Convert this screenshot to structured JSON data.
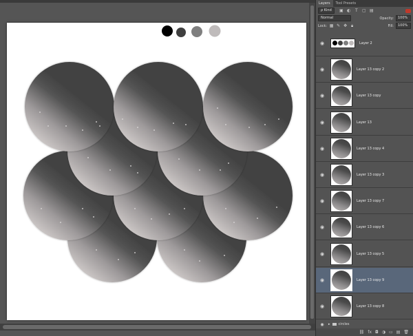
{
  "panel": {
    "tabs": [
      "Layers",
      "Tool Presets"
    ],
    "kind_label": "ρ Kind",
    "blend_mode": "Normal",
    "opacity_label": "Opacity:",
    "opacity_value": "100%",
    "lock_label": "Lock:",
    "fill_label": "Fill:",
    "fill_value": "100%",
    "group_name": "circles"
  },
  "layers": [
    {
      "name": "Layer 2",
      "type": "swatch",
      "selected": false
    },
    {
      "name": "Layer 13 copy 2",
      "type": "circle",
      "selected": false
    },
    {
      "name": "Layer 13 copy",
      "type": "circle",
      "selected": false
    },
    {
      "name": "Layer 13",
      "type": "circle",
      "selected": false
    },
    {
      "name": "Layer 13 copy 4",
      "type": "circle",
      "selected": false
    },
    {
      "name": "Layer 13 copy 3",
      "type": "circle",
      "selected": false
    },
    {
      "name": "Layer 13 copy 7",
      "type": "circle",
      "selected": false
    },
    {
      "name": "Layer 13 copy 6",
      "type": "circle",
      "selected": false
    },
    {
      "name": "Layer 13 copy 5",
      "type": "circle",
      "selected": false
    },
    {
      "name": "Layer 13 copy 9",
      "type": "circle",
      "selected": true
    },
    {
      "name": "Layer 13 copy 8",
      "type": "circle",
      "selected": false
    }
  ],
  "palette": [
    "#000000",
    "#3f3f3f",
    "#7f7f7f",
    "#bfbbbb"
  ],
  "colors": {
    "selection": "#59677a",
    "panel_bg": "#535353",
    "circle_light": "#c6c1c0",
    "circle_dark": "#424242"
  },
  "icons": {
    "eye": "eye-icon",
    "folder": "folder-icon",
    "trash": "trash-icon",
    "new_layer": "new-layer-icon"
  }
}
